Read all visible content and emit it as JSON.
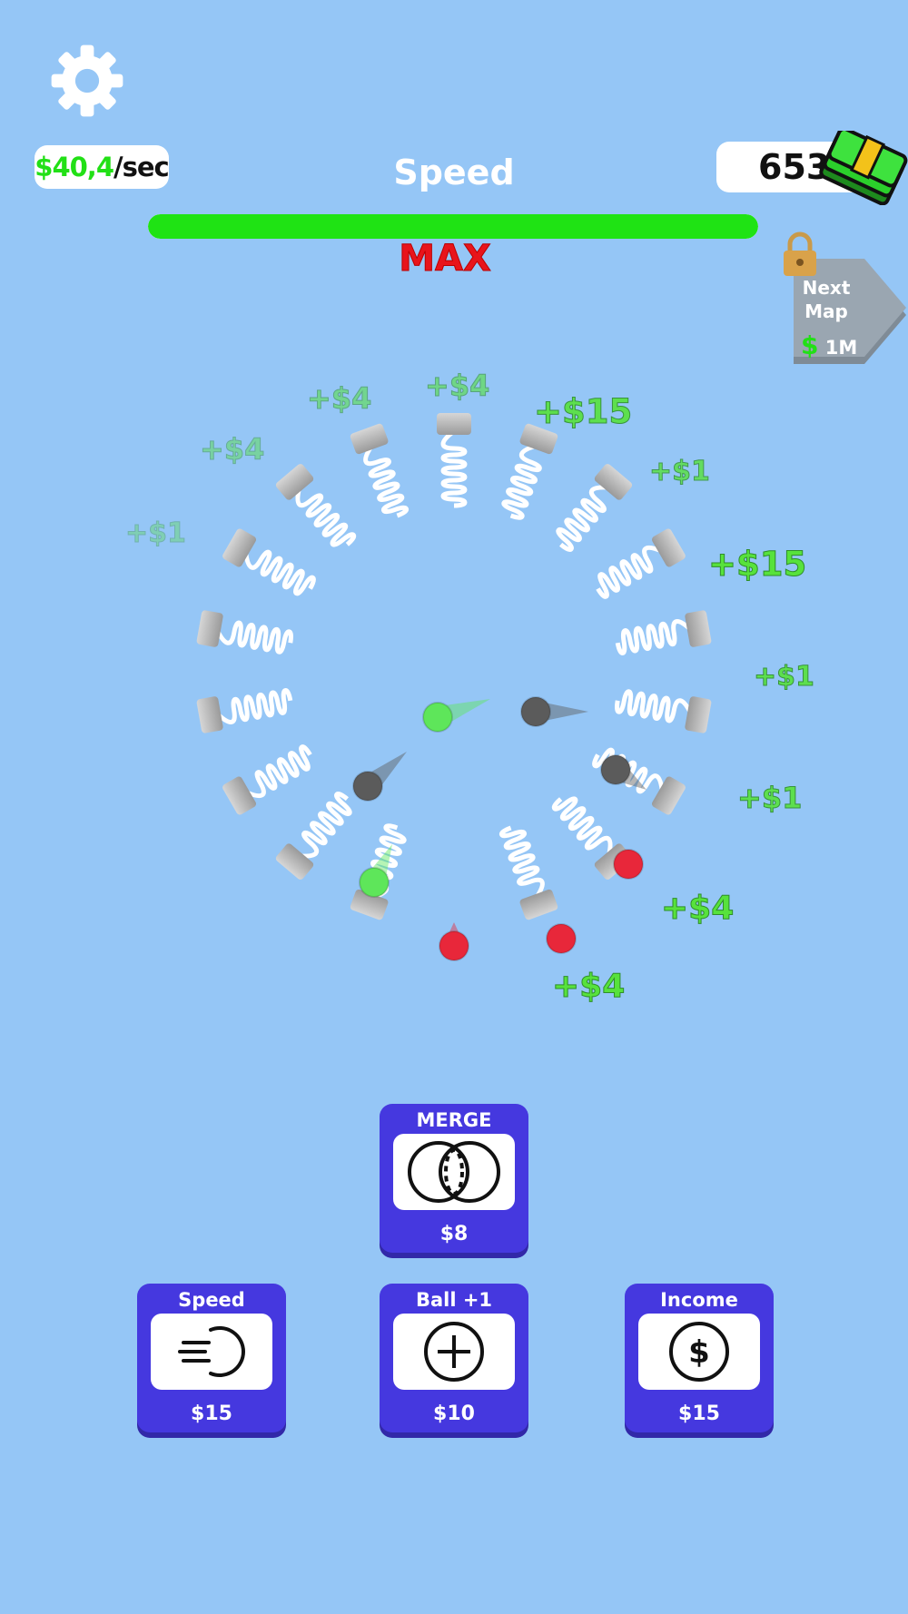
{
  "hud": {
    "income_value": "$40,4",
    "income_unit": "/sec",
    "cash": "653",
    "upgrade_title": "Speed",
    "upgrade_progress": 1.0,
    "max_label": "MAX"
  },
  "next_map": {
    "label": "Next Map",
    "price_symbol": "$",
    "price": "1M",
    "locked": true
  },
  "floating_rewards": [
    "+$4",
    "+$4",
    "+$15",
    "+$4",
    "+$1",
    "+$1",
    "+$15",
    "+$1",
    "+$1",
    "+$4",
    "+$4"
  ],
  "buttons": {
    "merge": {
      "title": "MERGE",
      "price": "$8",
      "icon": "merge-circles-icon"
    },
    "speed": {
      "title": "Speed",
      "price": "$15",
      "icon": "speed-lines-icon"
    },
    "ball": {
      "title": "Ball +1",
      "price": "$10",
      "icon": "plus-circle-icon"
    },
    "income": {
      "title": "Income",
      "price": "$15",
      "icon": "dollar-circle-icon"
    }
  },
  "colors": {
    "background": "#95c6f6",
    "button": "#4538df",
    "progress": "#1fe314",
    "max_text": "#e8141b",
    "ball_green": "#5ee65a",
    "ball_red": "#e8273a",
    "ball_gray": "#5b5b5b"
  }
}
